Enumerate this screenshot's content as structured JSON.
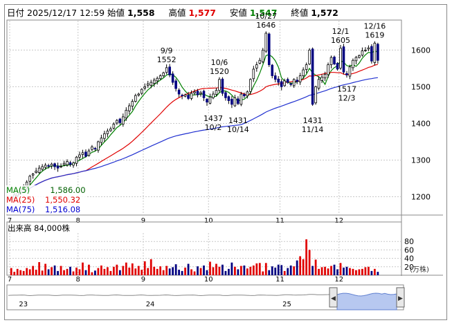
{
  "header": {
    "date_label": "日付",
    "date_value": "2025/12/17 12:59",
    "open_label": "始値",
    "open_value": "1,558",
    "high_label": "高値",
    "high_value": "1,577",
    "low_label": "安値",
    "low_value": "1,547",
    "close_label": "終値",
    "close_value": "1,572"
  },
  "ma_legend": [
    {
      "label": "MA(5)",
      "value": "1,586.00",
      "color": "#008000"
    },
    {
      "label": "MA(25)",
      "value": "1,550.32",
      "color": "#e00000"
    },
    {
      "label": "MA(75)",
      "value": "1,516.08",
      "color": "#0000d0"
    }
  ],
  "volume_title": "出来高  84,000株",
  "volume_unit": "(万株)",
  "colors": {
    "up": "#e00000",
    "down": "#000080",
    "ma5": "#008000",
    "ma25": "#e00000",
    "ma75": "#2030d0",
    "grid": "#c8c8c8"
  },
  "chart_data": {
    "type": "candlestick",
    "x_month_labels": [
      {
        "label": "7",
        "day": 0
      },
      {
        "label": "8",
        "day": 22
      },
      {
        "label": "9",
        "day": 43
      },
      {
        "label": "10",
        "day": 64
      },
      {
        "label": "11",
        "day": 87
      },
      {
        "label": "12",
        "day": 106
      }
    ],
    "y_ticks": [
      1200,
      1300,
      1400,
      1500,
      1600
    ],
    "ylim": [
      1150,
      1680
    ],
    "volume_ticks": [
      20,
      40,
      60,
      80
    ],
    "volume_ylim": [
      0,
      100
    ],
    "annotations": [
      {
        "text": "9/9\n1552",
        "day": 50,
        "value": 1552,
        "pos": "above"
      },
      {
        "text": "10/6\n1520",
        "day": 67,
        "value": 1520,
        "pos": "above"
      },
      {
        "text": "10/27\n1646",
        "day": 82,
        "value": 1646,
        "pos": "above"
      },
      {
        "text": "12/1\n1605",
        "day": 106,
        "value": 1605,
        "pos": "above"
      },
      {
        "text": "12/16\n1619",
        "day": 117,
        "value": 1619,
        "pos": "above"
      },
      {
        "text": "1437\n10/2",
        "day": 65,
        "value": 1437,
        "pos": "below"
      },
      {
        "text": "1431\n10/14",
        "day": 73,
        "value": 1431,
        "pos": "below"
      },
      {
        "text": "1431\n11/14",
        "day": 97,
        "value": 1431,
        "pos": "below"
      },
      {
        "text": "1517\n12/3",
        "day": 108,
        "value": 1517,
        "pos": "below"
      }
    ],
    "closes": [
      1198,
      1205,
      1212,
      1222,
      1228,
      1240,
      1256,
      1262,
      1270,
      1278,
      1282,
      1286,
      1284,
      1289,
      1282,
      1278,
      1283,
      1291,
      1296,
      1288,
      1292,
      1308,
      1314,
      1320,
      1310,
      1325,
      1336,
      1330,
      1350,
      1360,
      1372,
      1379,
      1385,
      1398,
      1408,
      1402,
      1418,
      1436,
      1448,
      1460,
      1476,
      1480,
      1493,
      1500,
      1508,
      1512,
      1518,
      1523,
      1530,
      1538,
      1552,
      1532,
      1512,
      1495,
      1480,
      1476,
      1478,
      1468,
      1482,
      1486,
      1478,
      1484,
      1470,
      1458,
      1472,
      1480,
      1490,
      1520,
      1482,
      1470,
      1462,
      1452,
      1470,
      1454,
      1480,
      1475,
      1486,
      1520,
      1548,
      1560,
      1572,
      1600,
      1646,
      1560,
      1530,
      1520,
      1512,
      1500,
      1516,
      1512,
      1506,
      1520,
      1514,
      1530,
      1546,
      1560,
      1600,
      1452,
      1500,
      1520,
      1526,
      1534,
      1560,
      1580,
      1562,
      1548,
      1605,
      1540,
      1532,
      1554,
      1572,
      1580,
      1585,
      1598,
      1600,
      1606,
      1570,
      1619,
      1572
    ],
    "volumes": [
      17,
      8,
      15,
      12,
      10,
      17,
      14,
      22,
      13,
      31,
      11,
      27,
      14,
      19,
      23,
      10,
      22,
      12,
      15,
      20,
      9,
      18,
      14,
      30,
      12,
      25,
      7,
      11,
      17,
      23,
      15,
      19,
      10,
      20,
      25,
      12,
      22,
      30,
      18,
      28,
      16,
      22,
      13,
      33,
      17,
      38,
      20,
      15,
      21,
      12,
      22,
      16,
      19,
      26,
      13,
      10,
      18,
      27,
      14,
      9,
      21,
      17,
      23,
      12,
      32,
      19,
      27,
      20,
      25,
      10,
      15,
      30,
      20,
      14,
      22,
      23,
      16,
      20,
      23,
      28,
      29,
      9,
      29,
      12,
      21,
      18,
      25,
      24,
      10,
      17,
      23,
      21,
      35,
      45,
      38,
      85,
      60,
      22,
      37,
      15,
      19,
      20,
      16,
      22,
      25,
      14,
      29,
      18,
      20,
      17,
      15,
      12,
      14,
      15,
      19,
      20,
      10,
      15,
      8
    ]
  },
  "navigator": {
    "labels": [
      {
        "label": "23",
        "pos": 0.02
      },
      {
        "label": "24",
        "pos": 0.41
      },
      {
        "label": "25",
        "pos": 0.83
      }
    ],
    "left_button": "◀",
    "right_button": "▶"
  }
}
